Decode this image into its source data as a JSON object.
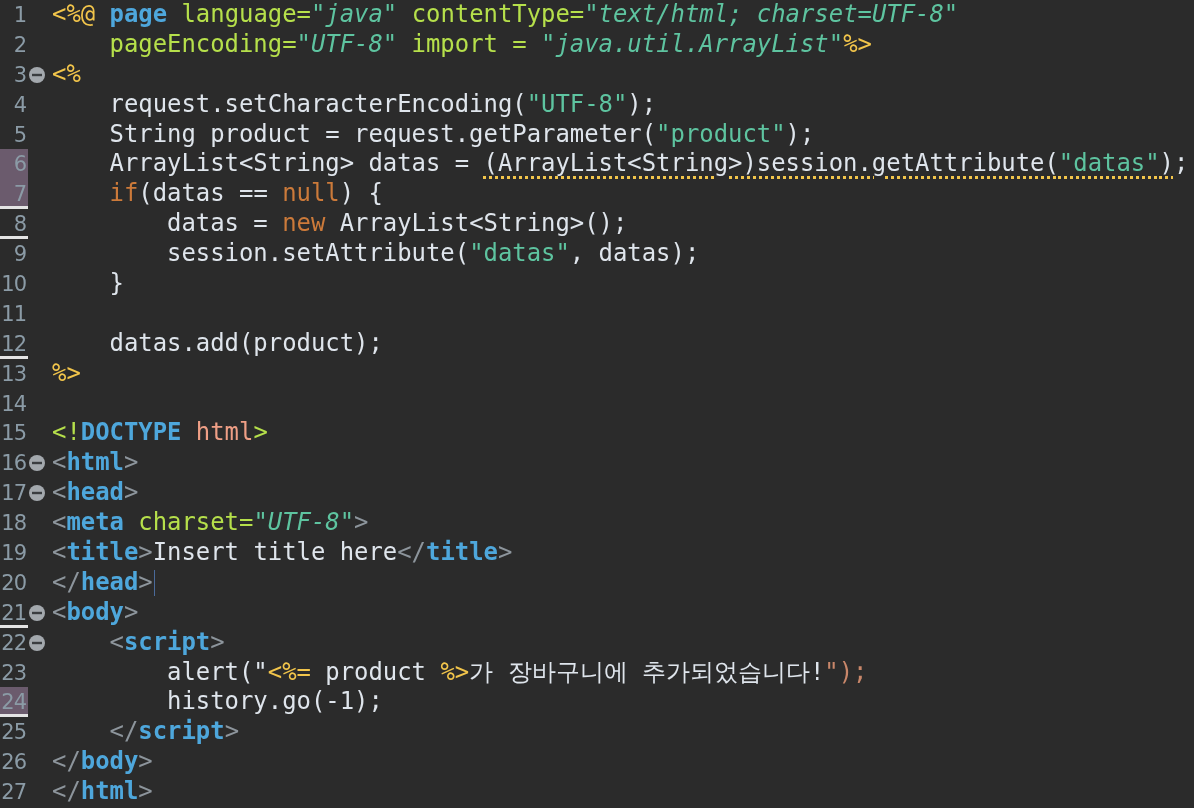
{
  "editor": {
    "lines": [
      {
        "number": "1",
        "tokens": [
          {
            "text": "<%@ ",
            "kind": "jsp"
          },
          {
            "text": "page",
            "kind": "directive"
          },
          {
            "text": " language=",
            "kind": "attr"
          },
          {
            "text": "\"java\"",
            "kind": "value"
          },
          {
            "text": " contentType=",
            "kind": "attr"
          },
          {
            "text": "\"text/html; charset=UTF-8\"",
            "kind": "value"
          }
        ]
      },
      {
        "number": "2",
        "tokens": [
          {
            "text": "    pageEncoding=",
            "kind": "attr"
          },
          {
            "text": "\"UTF-8\"",
            "kind": "value"
          },
          {
            "text": " import = ",
            "kind": "attr"
          },
          {
            "text": "\"java.util.ArrayList\"",
            "kind": "value"
          },
          {
            "text": "%>",
            "kind": "jsp"
          }
        ]
      },
      {
        "number": "3",
        "fold": true,
        "tokens": [
          {
            "text": "<%",
            "kind": "jsp"
          }
        ]
      },
      {
        "number": "4",
        "tokens": [
          {
            "text": "    request.setCharacterEncoding(",
            "kind": "plain"
          },
          {
            "text": "\"UTF-8\"",
            "kind": "string"
          },
          {
            "text": ");",
            "kind": "plain"
          }
        ]
      },
      {
        "number": "5",
        "tokens": [
          {
            "text": "    String product = request.getParameter(",
            "kind": "plain"
          },
          {
            "text": "\"product\"",
            "kind": "string"
          },
          {
            "text": ");",
            "kind": "plain"
          }
        ]
      },
      {
        "number": "6",
        "marked": true,
        "tokens": [
          {
            "text": "    ArrayList<String> datas = ",
            "kind": "plain"
          },
          {
            "text": "(ArrayList<String>)session.getAttribute(",
            "kind": "plain",
            "warning": true
          },
          {
            "text": "\"datas\"",
            "kind": "string",
            "warning": true
          },
          {
            "text": ")",
            "kind": "plain",
            "warning": true
          },
          {
            "text": ";",
            "kind": "plain"
          }
        ]
      },
      {
        "number": "7",
        "marked": true,
        "rule_below": true,
        "tokens": [
          {
            "text": "    if",
            "kind": "keyword"
          },
          {
            "text": "(datas == ",
            "kind": "plain"
          },
          {
            "text": "null",
            "kind": "keyword"
          },
          {
            "text": ") {",
            "kind": "plain"
          }
        ]
      },
      {
        "number": "8",
        "rule_below": true,
        "tokens": [
          {
            "text": "        datas = ",
            "kind": "plain"
          },
          {
            "text": "new",
            "kind": "keyword"
          },
          {
            "text": " ArrayList<String>();",
            "kind": "plain"
          }
        ]
      },
      {
        "number": "9",
        "tokens": [
          {
            "text": "        session.setAttribute(",
            "kind": "plain"
          },
          {
            "text": "\"datas\"",
            "kind": "string"
          },
          {
            "text": ", datas);",
            "kind": "plain"
          }
        ]
      },
      {
        "number": "10",
        "tokens": [
          {
            "text": "    }",
            "kind": "plain"
          }
        ]
      },
      {
        "number": "11"
      },
      {
        "number": "12",
        "rule_below": true,
        "tokens": [
          {
            "text": "    datas.add(product);",
            "kind": "plain"
          }
        ]
      },
      {
        "number": "13",
        "tokens": [
          {
            "text": "%>",
            "kind": "jsp"
          }
        ]
      },
      {
        "number": "14"
      },
      {
        "number": "15",
        "tokens": [
          {
            "text": "<!",
            "kind": "attr"
          },
          {
            "text": "DOCTYPE",
            "kind": "tag"
          },
          {
            "text": " html",
            "kind": "doctype"
          },
          {
            "text": ">",
            "kind": "attr"
          }
        ]
      },
      {
        "number": "16",
        "fold": true,
        "tokens": [
          {
            "text": "<",
            "kind": "bracket"
          },
          {
            "text": "html",
            "kind": "tag"
          },
          {
            "text": ">",
            "kind": "bracket"
          }
        ]
      },
      {
        "number": "17",
        "fold": true,
        "tokens": [
          {
            "text": "<",
            "kind": "bracket"
          },
          {
            "text": "head",
            "kind": "tag"
          },
          {
            "text": ">",
            "kind": "bracket"
          }
        ]
      },
      {
        "number": "18",
        "tokens": [
          {
            "text": "<",
            "kind": "bracket"
          },
          {
            "text": "meta",
            "kind": "tag"
          },
          {
            "text": " charset=",
            "kind": "attr"
          },
          {
            "text": "\"UTF-8\"",
            "kind": "value"
          },
          {
            "text": ">",
            "kind": "bracket"
          }
        ]
      },
      {
        "number": "19",
        "tokens": [
          {
            "text": "<",
            "kind": "bracket"
          },
          {
            "text": "title",
            "kind": "tag"
          },
          {
            "text": ">",
            "kind": "bracket"
          },
          {
            "text": "Insert title here",
            "kind": "plain"
          },
          {
            "text": "</",
            "kind": "bracket"
          },
          {
            "text": "title",
            "kind": "tag"
          },
          {
            "text": ">",
            "kind": "bracket"
          }
        ]
      },
      {
        "number": "20",
        "cursor": true,
        "tokens": [
          {
            "text": "</",
            "kind": "bracket"
          },
          {
            "text": "head",
            "kind": "tag"
          },
          {
            "text": ">",
            "kind": "bracket"
          }
        ]
      },
      {
        "number": "21",
        "fold": true,
        "rule_below": true,
        "tokens": [
          {
            "text": "<",
            "kind": "bracket"
          },
          {
            "text": "body",
            "kind": "tag"
          },
          {
            "text": ">",
            "kind": "bracket"
          }
        ]
      },
      {
        "number": "22",
        "fold": true,
        "tokens": [
          {
            "text": "    <",
            "kind": "bracket"
          },
          {
            "text": "script",
            "kind": "tag"
          },
          {
            "text": ">",
            "kind": "bracket"
          }
        ]
      },
      {
        "number": "23",
        "tokens": [
          {
            "text": "        alert(\"",
            "kind": "plain"
          },
          {
            "text": "<%=",
            "kind": "jsp"
          },
          {
            "text": " product ",
            "kind": "plain"
          },
          {
            "text": "%>",
            "kind": "jsp"
          },
          {
            "text": "가 장바구니에 추가되었습니다!",
            "kind": "plain"
          },
          {
            "text": "\");",
            "kind": "jsstring"
          }
        ]
      },
      {
        "number": "24",
        "marked": true,
        "rule_below": true,
        "tokens": [
          {
            "text": "        history.go(-1);",
            "kind": "plain"
          }
        ]
      },
      {
        "number": "25",
        "tokens": [
          {
            "text": "    </",
            "kind": "bracket"
          },
          {
            "text": "script",
            "kind": "tag"
          },
          {
            "text": ">",
            "kind": "bracket"
          }
        ]
      },
      {
        "number": "26",
        "tokens": [
          {
            "text": "</",
            "kind": "bracket"
          },
          {
            "text": "body",
            "kind": "tag"
          },
          {
            "text": ">",
            "kind": "bracket"
          }
        ]
      },
      {
        "number": "27",
        "tokens": [
          {
            "text": "</",
            "kind": "bracket"
          },
          {
            "text": "html",
            "kind": "tag"
          },
          {
            "text": ">",
            "kind": "bracket"
          }
        ]
      }
    ]
  }
}
